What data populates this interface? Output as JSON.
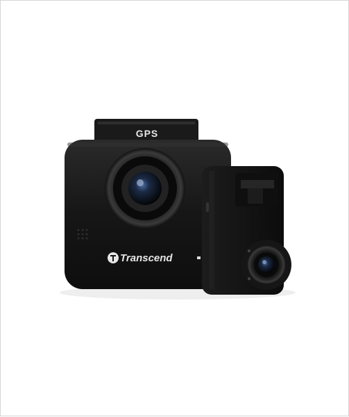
{
  "photo": {
    "subject_icon": "dash-camera-photo-icon",
    "gps_text": "GPS",
    "brand_text": "Transcend",
    "logo_icon": "transcend-logo-icon",
    "colors": {
      "frame_border": "#d6d6d6",
      "camera_body": "#141414",
      "lens_glass": "#1b2a44",
      "background": "#ffffff"
    }
  }
}
